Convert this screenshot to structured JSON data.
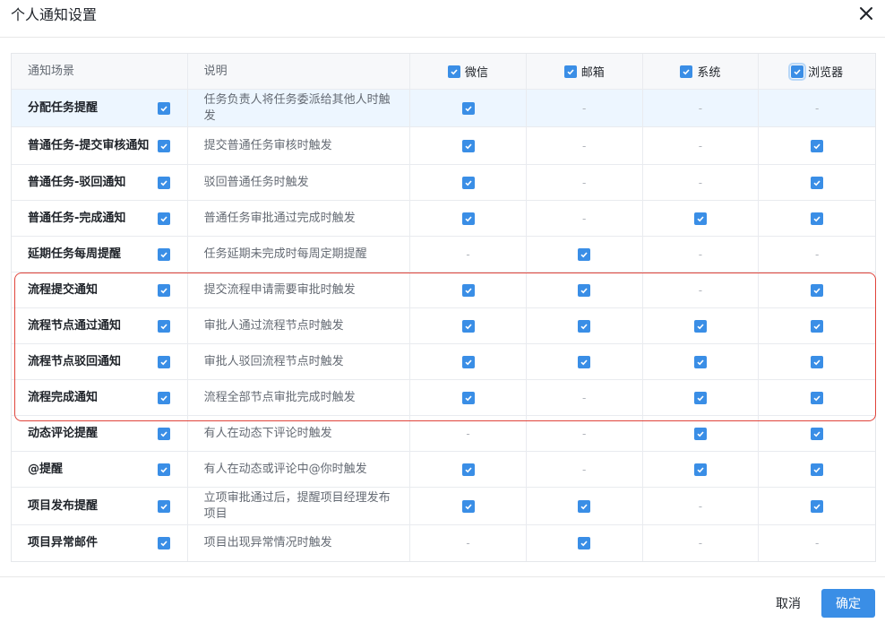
{
  "dialog": {
    "title": "个人通知设置"
  },
  "table": {
    "headers": {
      "scene": "通知场景",
      "desc": "说明",
      "wechat": "微信",
      "email": "邮箱",
      "system": "系统",
      "browser": "浏览器"
    },
    "dash": "-",
    "rows": [
      {
        "scene": "分配任务提醒",
        "desc": "任务负责人将任务委派给其他人时触发",
        "wechat": true,
        "email": false,
        "system": false,
        "browser": false
      },
      {
        "scene": "普通任务-提交审核通知",
        "desc": "提交普通任务审核时触发",
        "wechat": true,
        "email": false,
        "system": false,
        "browser": true
      },
      {
        "scene": "普通任务-驳回通知",
        "desc": "驳回普通任务时触发",
        "wechat": true,
        "email": false,
        "system": false,
        "browser": true
      },
      {
        "scene": "普通任务-完成通知",
        "desc": "普通任务审批通过完成时触发",
        "wechat": true,
        "email": false,
        "system": true,
        "browser": true
      },
      {
        "scene": "延期任务每周提醒",
        "desc": "任务延期未完成时每周定期提醒",
        "wechat": false,
        "email": true,
        "system": false,
        "browser": false
      },
      {
        "scene": "流程提交通知",
        "desc": "提交流程申请需要审批时触发",
        "wechat": true,
        "email": true,
        "system": false,
        "browser": true
      },
      {
        "scene": "流程节点通过通知",
        "desc": "审批人通过流程节点时触发",
        "wechat": true,
        "email": true,
        "system": true,
        "browser": true
      },
      {
        "scene": "流程节点驳回通知",
        "desc": "审批人驳回流程节点时触发",
        "wechat": true,
        "email": true,
        "system": true,
        "browser": true
      },
      {
        "scene": "流程完成通知",
        "desc": "流程全部节点审批完成时触发",
        "wechat": true,
        "email": false,
        "system": true,
        "browser": true
      },
      {
        "scene": "动态评论提醒",
        "desc": "有人在动态下评论时触发",
        "wechat": false,
        "email": false,
        "system": true,
        "browser": true
      },
      {
        "scene": "@提醒",
        "desc": "有人在动态或评论中@你时触发",
        "wechat": true,
        "email": false,
        "system": true,
        "browser": true
      },
      {
        "scene": "项目发布提醒",
        "desc": "立项审批通过后，提醒项目经理发布项目",
        "wechat": true,
        "email": true,
        "system": false,
        "browser": true
      },
      {
        "scene": "项目异常邮件",
        "desc": "项目出现异常情况时触发",
        "wechat": false,
        "email": true,
        "system": false,
        "browser": false
      }
    ]
  },
  "footer": {
    "cancel": "取消",
    "confirm": "确定"
  },
  "colors": {
    "primary": "#3a8ee6",
    "highlight_row": "#edf6ff",
    "annotation_box": "#e0443b"
  }
}
